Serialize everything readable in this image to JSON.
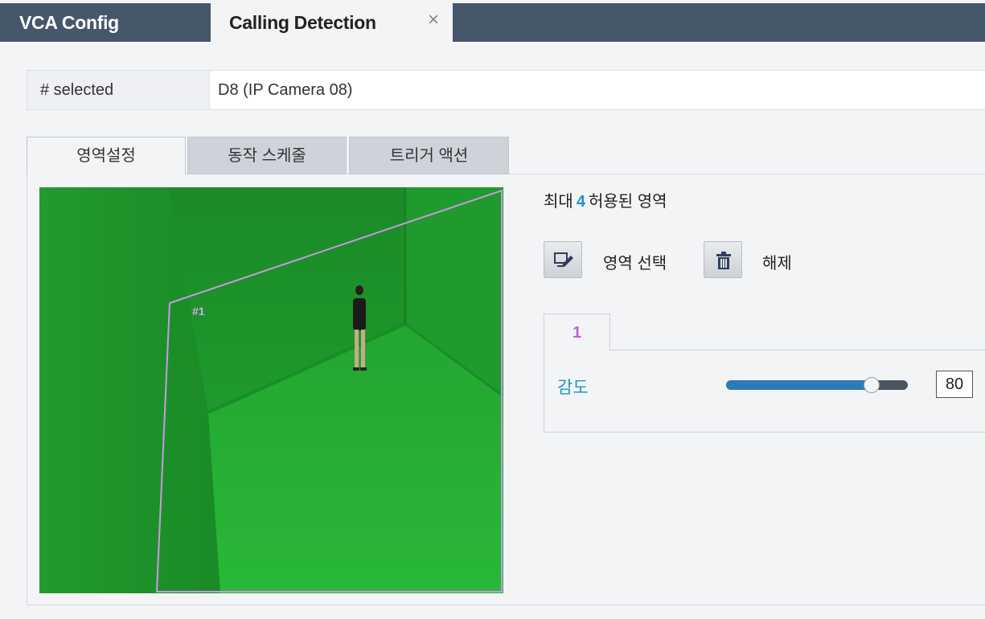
{
  "tabs": {
    "vca_config": "VCA Config",
    "calling_detection": "Calling Detection",
    "close_symbol": "×"
  },
  "selected": {
    "label": "# selected",
    "value": "D8 (IP Camera 08)"
  },
  "panel_tabs": [
    "영역설정",
    "동작 스케줄",
    "트리거 액션"
  ],
  "active_panel_tab": "영역설정",
  "video": {
    "region_label": "#1",
    "region_color": "#c59ae3"
  },
  "max_regions": {
    "prefix": "최대",
    "count": "4",
    "suffix": "허용된 영역"
  },
  "actions": {
    "select_region": "영역 선택",
    "clear": "해제"
  },
  "zone": {
    "tab_label": "1",
    "sensitivity_label": "감도",
    "sensitivity_value": "80",
    "sensitivity_fraction": 0.8
  },
  "colors": {
    "topbar": "#46576b",
    "accent_blue": "#1c95c8",
    "zone_purple": "#c060d8"
  }
}
